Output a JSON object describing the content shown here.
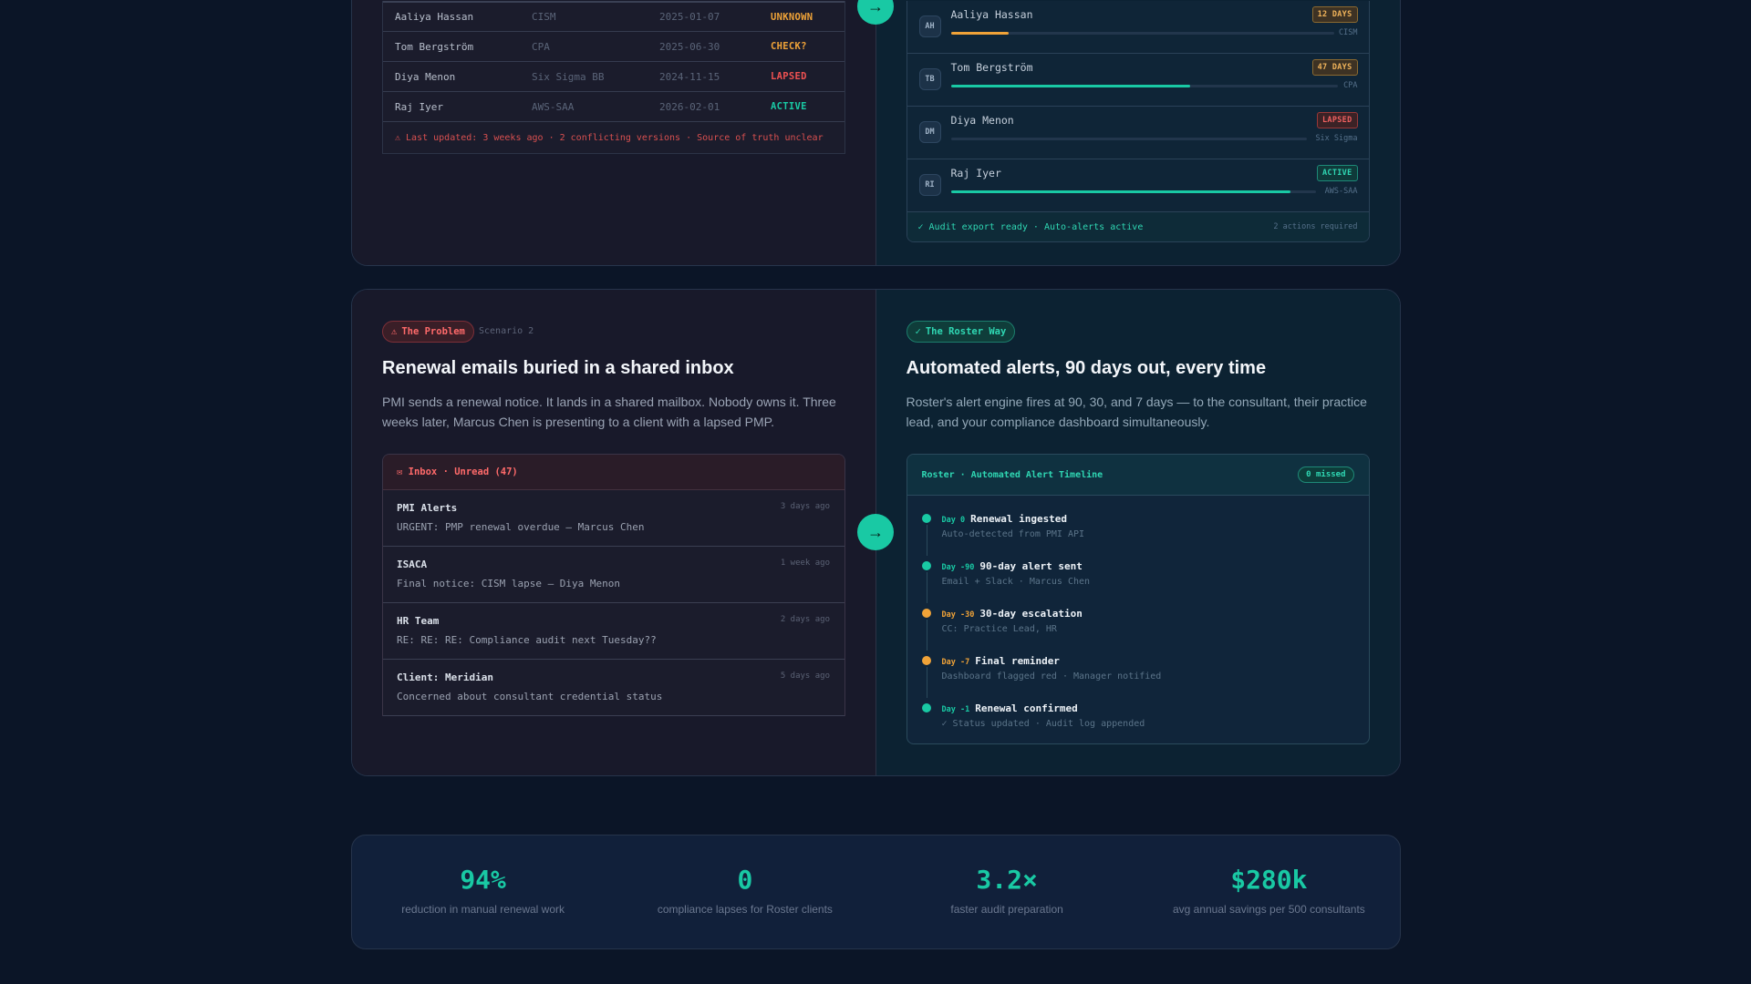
{
  "scenario1": {
    "problem_table": {
      "rows": [
        {
          "name": "Aaliya Hassan",
          "cert": "CISM",
          "date": "2025-01-07",
          "status": "UNKNOWN",
          "status_kind": "unknown"
        },
        {
          "name": "Tom Bergström",
          "cert": "CPA",
          "date": "2025-06-30",
          "status": "CHECK?",
          "status_kind": "check"
        },
        {
          "name": "Diya Menon",
          "cert": "Six Sigma BB",
          "date": "2024-11-15",
          "status": "LAPSED",
          "status_kind": "lapsed"
        },
        {
          "name": "Raj Iyer",
          "cert": "AWS-SAA",
          "date": "2026-02-01",
          "status": "ACTIVE",
          "status_kind": "active"
        }
      ],
      "footer": "⚠ Last updated: 3 weeks ago · 2 conflicting versions · Source of truth unclear"
    },
    "roster_list": {
      "rows": [
        {
          "initials": "AH",
          "name": "Aaliya Hassan",
          "badge": "12 DAYS",
          "badge_kind": "warn",
          "progress": 0.15,
          "bar_color": "#f0a338",
          "cert": "CISM"
        },
        {
          "initials": "TB",
          "name": "Tom Bergström",
          "badge": "47 DAYS",
          "badge_kind": "warn",
          "progress": 0.62,
          "bar_color": "#19c9a4",
          "cert": "CPA"
        },
        {
          "initials": "DM",
          "name": "Diya Menon",
          "badge": "LAPSED",
          "badge_kind": "lapsed",
          "progress": 0,
          "bar_color": "#ef5151",
          "cert": "Six Sigma"
        },
        {
          "initials": "RI",
          "name": "Raj Iyer",
          "badge": "ACTIVE",
          "badge_kind": "active",
          "progress": 0.93,
          "bar_color": "#19c9a4",
          "cert": "AWS-SAA"
        }
      ],
      "footer_left": "✓ Audit export ready · Auto-alerts active",
      "footer_right": "2 actions required"
    },
    "arrow": "→"
  },
  "scenario2": {
    "problem": {
      "pill": "The Problem",
      "pill_icon": "⚠",
      "scenario_label": "Scenario 2",
      "title": "Renewal emails buried in a shared inbox",
      "description": "PMI sends a renewal notice. It lands in a shared mailbox. Nobody owns it. Three weeks later, Marcus Chen is presenting to a client with a lapsed PMP.",
      "inbox_header": "✉ Inbox · Unread (47)",
      "emails": [
        {
          "from": "PMI Alerts",
          "time": "3 days ago",
          "subject": "URGENT: PMP renewal overdue — Marcus Chen"
        },
        {
          "from": "ISACA",
          "time": "1 week ago",
          "subject": "Final notice: CISM lapse — Diya Menon"
        },
        {
          "from": "HR Team",
          "time": "2 days ago",
          "subject": "RE: RE: RE: Compliance audit next Tuesday??"
        },
        {
          "from": "Client: Meridian",
          "time": "5 days ago",
          "subject": "Concerned about consultant credential status"
        }
      ]
    },
    "solution": {
      "pill": "The Roster Way",
      "pill_icon": "✓",
      "title": "Automated alerts, 90 days out, every time",
      "description": "Roster's alert engine fires at 90, 30, and 7 days — to the consultant, their practice lead, and your compliance dashboard simultaneously.",
      "timeline_header": "Roster · Automated Alert Timeline",
      "missed_badge": "0 missed",
      "events": [
        {
          "day": "Day 0",
          "title": "Renewal ingested",
          "sub": "Auto-detected from PMI API",
          "color": "green"
        },
        {
          "day": "Day -90",
          "title": "90-day alert sent",
          "sub": "Email + Slack · Marcus Chen",
          "color": "green"
        },
        {
          "day": "Day -30",
          "title": "30-day escalation",
          "sub": "CC: Practice Lead, HR",
          "color": "orange"
        },
        {
          "day": "Day -7",
          "title": "Final reminder",
          "sub": "Dashboard flagged red · Manager notified",
          "color": "orange"
        },
        {
          "day": "Day -1",
          "title": "Renewal confirmed",
          "sub": "✓ Status updated · Audit log appended",
          "color": "green"
        }
      ]
    },
    "arrow": "→"
  },
  "stats": [
    {
      "value": "94%",
      "label": "reduction in manual renewal work"
    },
    {
      "value": "0",
      "label": "compliance lapses for Roster clients"
    },
    {
      "value": "3.2×",
      "label": "faster audit preparation"
    },
    {
      "value": "$280k",
      "label": "avg annual savings per 500 consultants"
    }
  ],
  "colors": {
    "accent": "#19c9a4",
    "warning": "#f0a338",
    "danger": "#ef5151",
    "background": "#0b1527"
  }
}
